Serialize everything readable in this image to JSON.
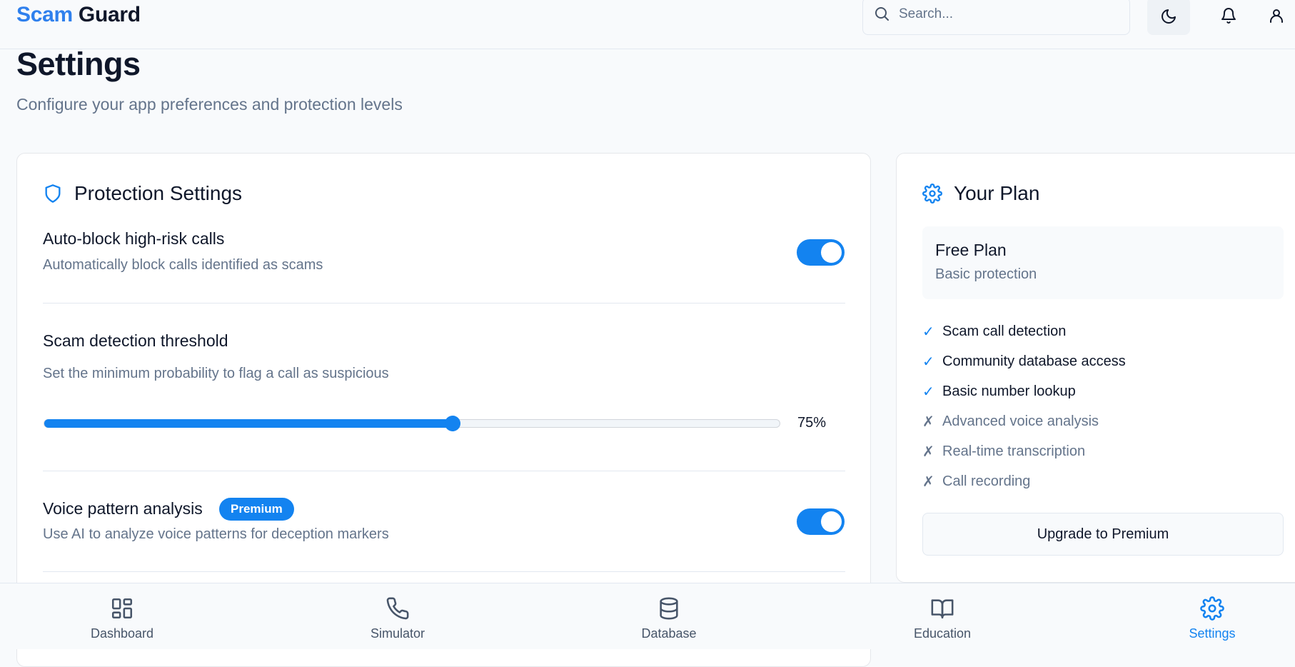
{
  "header": {
    "brand_part1": "Scam",
    "brand_part2": "Guard",
    "search_placeholder": "Search..."
  },
  "page": {
    "title": "Settings",
    "subtitle": "Configure your app preferences and protection levels"
  },
  "protection": {
    "title": "Protection Settings",
    "auto_block": {
      "title": "Auto-block high-risk calls",
      "description": "Automatically block calls identified as scams",
      "enabled": true
    },
    "threshold": {
      "title": "Scam detection threshold",
      "description": "Set the minimum probability to flag a call as suspicious",
      "value_label": "75%",
      "slider_fraction": 0.555
    },
    "voice_analysis": {
      "title": "Voice pattern analysis",
      "badge": "Premium",
      "description": "Use AI to analyze voice patterns for deception markers",
      "enabled": true
    }
  },
  "plan": {
    "title": "Your Plan",
    "name": "Free Plan",
    "description": "Basic protection",
    "features": [
      {
        "label": "Scam call detection",
        "included": true,
        "mark": "✓"
      },
      {
        "label": "Community database access",
        "included": true,
        "mark": "✓"
      },
      {
        "label": "Basic number lookup",
        "included": true,
        "mark": "✓"
      },
      {
        "label": "Advanced voice analysis",
        "included": false,
        "mark": "✗"
      },
      {
        "label": "Real-time transcription",
        "included": false,
        "mark": "✗"
      },
      {
        "label": "Call recording",
        "included": false,
        "mark": "✗"
      }
    ],
    "upgrade_label": "Upgrade to Premium"
  },
  "nav": {
    "items": [
      {
        "label": "Dashboard",
        "icon": "dashboard-icon"
      },
      {
        "label": "Simulator",
        "icon": "phone-icon"
      },
      {
        "label": "Database",
        "icon": "database-icon"
      },
      {
        "label": "Education",
        "icon": "book-icon"
      },
      {
        "label": "Settings",
        "icon": "gear-icon",
        "active": true
      }
    ]
  },
  "colors": {
    "accent": "#1383f0",
    "brand_blue": "#2f80ed",
    "muted_text": "#64748b",
    "background": "#f8fafc"
  }
}
